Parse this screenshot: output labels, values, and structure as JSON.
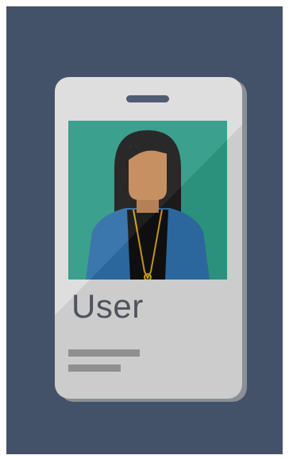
{
  "card": {
    "name": "User"
  },
  "colors": {
    "background": "#445269",
    "card": "#dcdcdc",
    "photo_background": "#2f9b86",
    "jacket": "#2f6fa8",
    "skin": "#c48a5a",
    "hair": "#1c1c1c",
    "lanyard": "#d4a017"
  },
  "icons": {
    "avatar": "user-avatar-icon"
  }
}
